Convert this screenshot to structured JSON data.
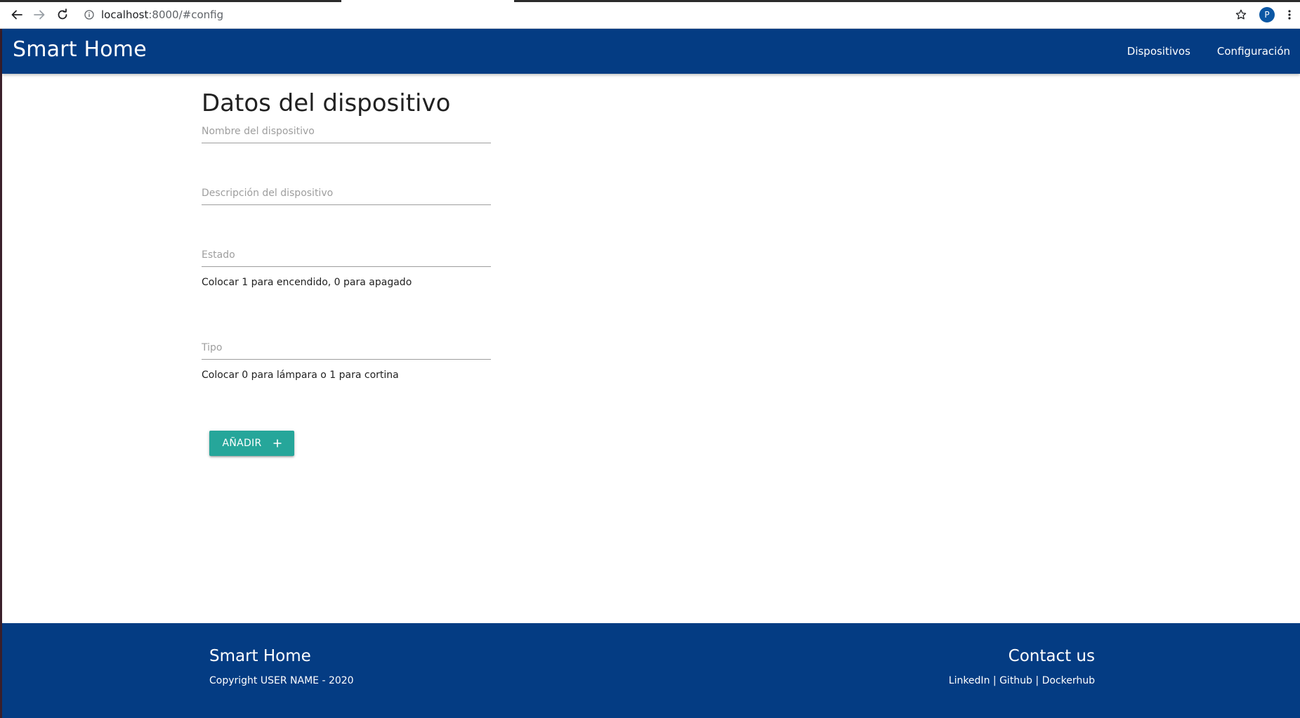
{
  "browser": {
    "url_host": "localhost",
    "url_path": ":8000/#config",
    "profile_initial": "P"
  },
  "header": {
    "brand": "Smart Home",
    "nav": [
      "Dispositivos",
      "Configuración"
    ],
    "color": "#043c83"
  },
  "form": {
    "title": "Datos del dispositivo",
    "fields": [
      {
        "placeholder": "Nombre del dispositivo",
        "value": ""
      },
      {
        "placeholder": "Descripción del dispositivo",
        "value": ""
      },
      {
        "placeholder": "Estado",
        "value": "",
        "helper": "Colocar 1 para encendido, 0 para apagado"
      },
      {
        "placeholder": "Tipo",
        "value": "",
        "helper": "Colocar 0 para lámpara o 1 para cortina"
      }
    ],
    "submit_label": "AÑADIR",
    "submit_icon": "plus-icon",
    "submit_color": "#26a69a"
  },
  "footer": {
    "brand": "Smart Home",
    "copyright": "Copyright USER NAME - 2020",
    "contact_title": "Contact us",
    "links": [
      "LinkedIn",
      "Github",
      "Dockerhub"
    ],
    "separator": "|"
  }
}
